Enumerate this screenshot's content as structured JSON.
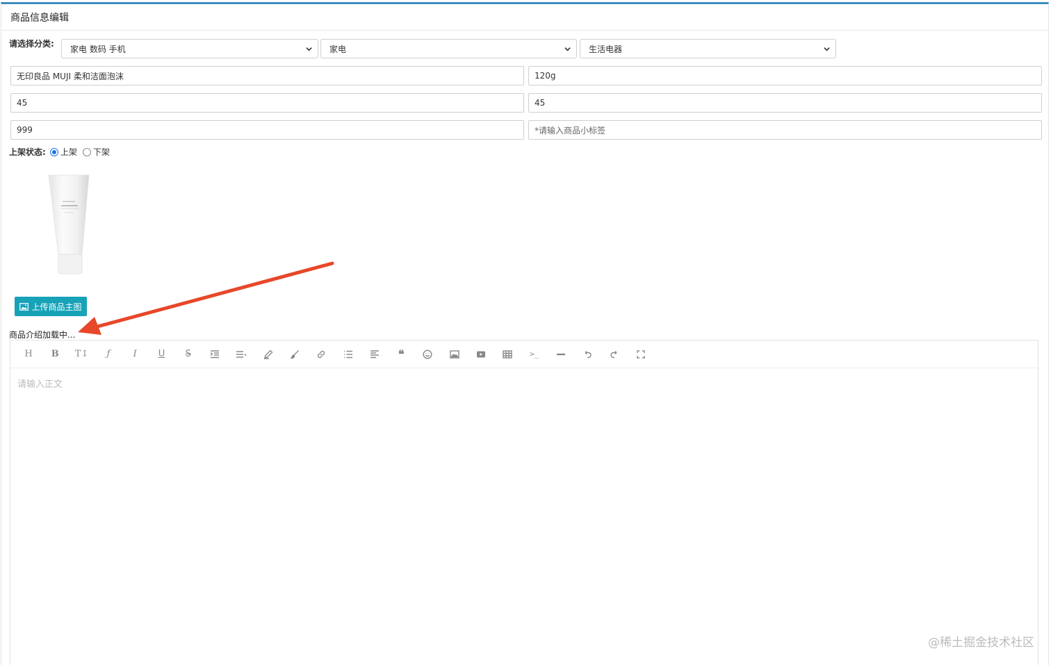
{
  "panel": {
    "title": "商品信息编辑"
  },
  "category": {
    "label": "请选择分类:",
    "level1": "家电 数码 手机",
    "level2": "家电",
    "level3": "生活电器"
  },
  "fields": {
    "name": "无印良品 MUJI 柔和洁面泡沫",
    "spec": "120g",
    "price": "45",
    "price2": "45",
    "stock": "999",
    "tag_placeholder": "*请输入商品小标签"
  },
  "status": {
    "label": "上架状态:",
    "on": "上架",
    "off": "下架",
    "selected": "上架"
  },
  "upload": {
    "label": "上传商品主图"
  },
  "intro": {
    "label": "商品介绍加载中..."
  },
  "editor": {
    "placeholder": "请输入正文",
    "toolbar": [
      "heading-icon",
      "bold-icon",
      "font-size-icon",
      "font-family-icon",
      "italic-icon",
      "underline-icon",
      "strikethrough-icon",
      "indent-icon",
      "line-height-icon",
      "font-color-icon",
      "background-color-icon",
      "link-icon",
      "list-icon",
      "justify-icon",
      "quote-icon",
      "emoticon-icon",
      "image-icon",
      "video-icon",
      "table-icon",
      "code-icon",
      "divider-icon",
      "undo-icon",
      "redo-icon",
      "fullscreen-icon"
    ]
  },
  "watermark": "@稀土掘金技术社区",
  "colors": {
    "accent": "#3c8dbc",
    "upload_button": "#17a2b8",
    "arrow": "#e8472a"
  }
}
